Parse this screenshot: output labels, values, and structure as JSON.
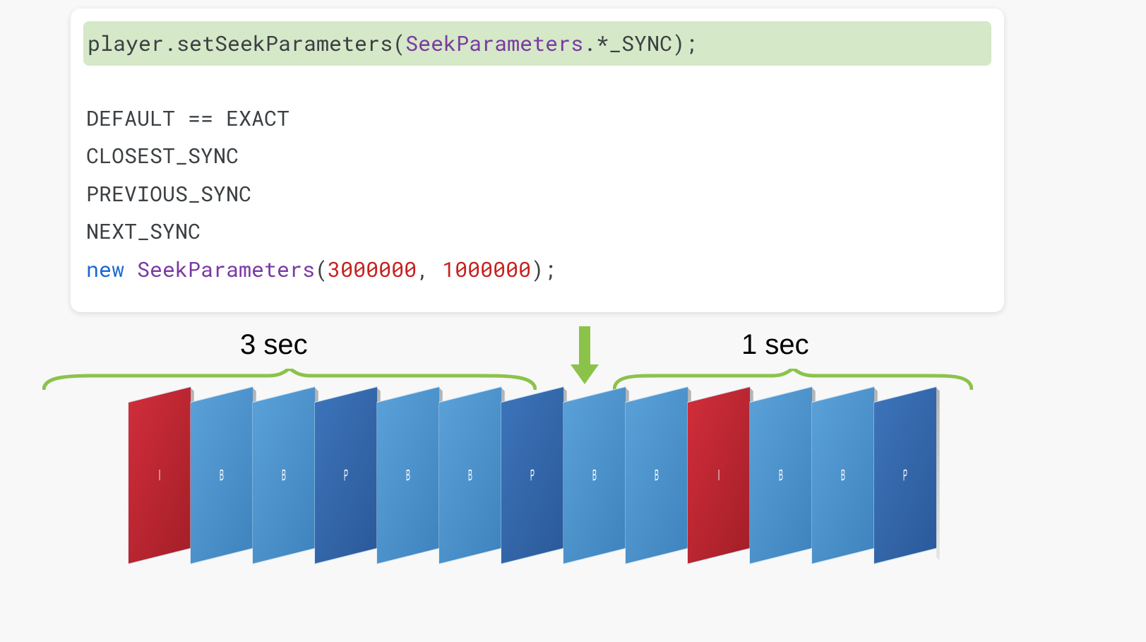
{
  "code": {
    "line1_prefix": "player.setSeekParameters(",
    "line1_type": "SeekParameters",
    "line1_suffix": ".*_SYNC);",
    "list1": "DEFAULT == EXACT",
    "list2": "CLOSEST_SYNC",
    "list3": "PREVIOUS_SYNC",
    "list4": "NEXT_SYNC",
    "ctor_kw": "new ",
    "ctor_type": "SeekParameters",
    "ctor_open": "(",
    "ctor_arg1": "3000000",
    "ctor_mid": ", ",
    "ctor_arg2": "1000000",
    "ctor_close": ");"
  },
  "diagram": {
    "leftLabel": "3 sec",
    "rightLabel": "1 sec",
    "frames": [
      {
        "type": "I",
        "label": "I"
      },
      {
        "type": "B",
        "label": "B"
      },
      {
        "type": "B",
        "label": "B"
      },
      {
        "type": "P",
        "label": "P"
      },
      {
        "type": "B",
        "label": "B"
      },
      {
        "type": "B",
        "label": "B"
      },
      {
        "type": "P",
        "label": "P"
      },
      {
        "type": "B",
        "label": "B"
      },
      {
        "type": "B",
        "label": "B"
      },
      {
        "type": "I",
        "label": "I"
      },
      {
        "type": "B",
        "label": "B"
      },
      {
        "type": "B",
        "label": "B"
      },
      {
        "type": "P",
        "label": "P"
      }
    ],
    "brace_color": "#8bc34a"
  }
}
